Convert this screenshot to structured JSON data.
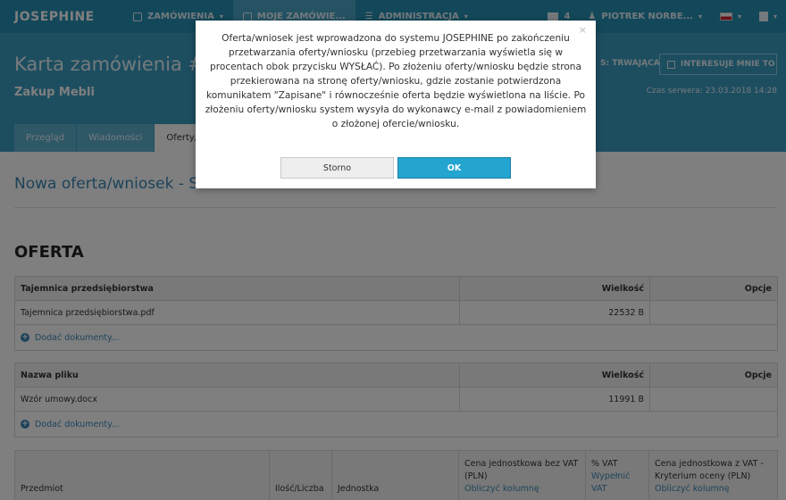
{
  "navbar": {
    "logo": "JOSEPHINE",
    "items": [
      {
        "label": "ZAMÓWIENIA"
      },
      {
        "label": "MOJE ZAMÓWIE..."
      },
      {
        "label": "ADMINISTRACJA"
      }
    ],
    "mail_count": "4",
    "user": "PIOTREK NORBE...",
    "caret": "▾"
  },
  "header": {
    "title": "Karta zamówienia #ZP",
    "subtitle": "Zakup Mebli",
    "status": "S: TRWAJĄCA",
    "interest_button": "INTERESUJE MNIE TO",
    "server_time": "Czas serwera: 23.03.2018 14:28"
  },
  "tabs": [
    {
      "label": "Przegląd"
    },
    {
      "label": "Wiadomości"
    },
    {
      "label": "Oferty/w"
    }
  ],
  "main": {
    "section_link": "Nowa oferta/wniosek - Skł",
    "oferta_title": "OFERTA",
    "tables": [
      {
        "headers": [
          "Tajemnica przedsiębiorstwa",
          "Wielkość",
          "Opcje"
        ],
        "rows": [
          [
            "Tajemnica przedsiębiorstwa.pdf",
            "22532 B",
            ""
          ]
        ],
        "add_label": "Dodać dokumenty..."
      },
      {
        "headers": [
          "Nazwa pliku",
          "Wielkość",
          "Opcje"
        ],
        "rows": [
          [
            "Wzór umowy.docx",
            "11991 B",
            ""
          ]
        ],
        "add_label": "Dodać dokumenty..."
      }
    ],
    "items_headers": {
      "przedmiot": "Przedmiot",
      "ilosc": "Ilość/Liczba",
      "jednostka": "Jednostka",
      "cena_bez_vat": "Cena jednostkowa bez VAT (PLN)",
      "cena_bez_vat_link": "Obliczyć kolumnę",
      "vat": "% VAT",
      "vat_link1": "Wypełnić",
      "vat_link2": "VAT",
      "cena_z_vat1": "Cena jednostkowa z VAT -",
      "cena_z_vat2": "Kryterium oceny (PLN)",
      "cena_z_vat_link": "Obliczyć kolumnę"
    }
  },
  "modal": {
    "message": "Oferta/wniosek jest wprowadzona do systemu JOSEPHINE po zakończeniu przetwarzania oferty/wniosku (przebieg przetwarzania wyświetla się w procentach obok przycisku WYSŁAĆ). Po złożeniu oferty/wniosku będzie strona przekierowana na stronę oferty/wniosku, gdzie zostanie potwierdzona komunikatem \"Zapisane\" i równocześnie oferta będzie wyświetlona na liście. Po złożeniu oferty/wniosku system wysyła do wykonawcy e-mail z powiadomieniem o złożonej ofercie/wniosku.",
    "close": "×",
    "cancel_label": "Storno",
    "ok_label": "OK"
  }
}
